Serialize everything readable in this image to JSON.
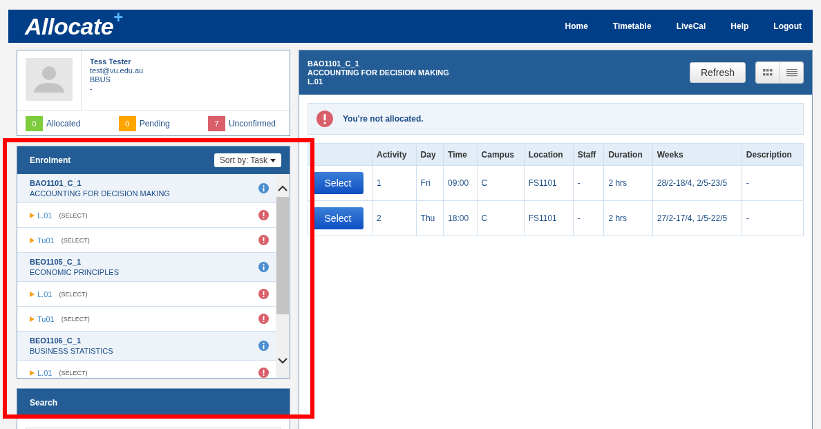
{
  "header": {
    "logo": "Allocate",
    "logo_mark": "+",
    "nav": [
      "Home",
      "Timetable",
      "LiveCal",
      "Help",
      "Logout"
    ]
  },
  "profile": {
    "name": "Tess Tester",
    "email": "test@vu.edu.au",
    "program": "BBUS",
    "extra": "-",
    "counts": [
      {
        "value": "0",
        "label": "Allocated",
        "color": "#7ccc3c"
      },
      {
        "value": "0",
        "label": "Pending",
        "color": "#ffa500"
      },
      {
        "value": "7",
        "label": "Unconfirmed",
        "color": "#d9606a"
      }
    ]
  },
  "enrolment": {
    "title": "Enrolment",
    "sort": "Sort by: Task",
    "courses": [
      {
        "code": "BAO1101_C_1",
        "name": "ACCOUNTING FOR DECISION MAKING",
        "children": [
          {
            "label": "L.01",
            "note": "(SELECT)"
          },
          {
            "label": "Tu01",
            "note": "(SELECT)"
          }
        ]
      },
      {
        "code": "BEO1105_C_1",
        "name": "ECONOMIC PRINCIPLES",
        "children": [
          {
            "label": "L.01",
            "note": "(SELECT)"
          },
          {
            "label": "Tu01",
            "note": "(SELECT)"
          }
        ]
      },
      {
        "code": "BEO1106_C_1",
        "name": "BUSINESS STATISTICS",
        "children": [
          {
            "label": "L.01",
            "note": "(SELECT)"
          }
        ]
      }
    ]
  },
  "search": {
    "title": "Search"
  },
  "detail": {
    "code": "BAO1101_C_1",
    "name": "ACCOUNTING FOR DECISION MAKING",
    "activity": "L.01",
    "refresh": "Refresh",
    "views": [
      {
        "kind": "grid",
        "selected": false
      },
      {
        "kind": "list",
        "selected": false
      }
    ],
    "message": "You're not allocated.",
    "table": {
      "columns": [
        "Activity",
        "Day",
        "Time",
        "Campus",
        "Location",
        "Staff",
        "Duration",
        "Weeks",
        "Description"
      ],
      "rows": [
        {
          "button": "Select",
          "cells": [
            "1",
            "Fri",
            "09:00",
            "C",
            "FS1101",
            "-",
            "2 hrs",
            "28/2-18/4, 2/5-23/5",
            "-"
          ]
        },
        {
          "button": "Select",
          "cells": [
            "2",
            "Thu",
            "18:00",
            "C",
            "FS1101",
            "-",
            "2 hrs",
            "27/2-17/4, 1/5-22/5",
            "-"
          ]
        }
      ]
    }
  },
  "annotation": {
    "kind": "frame",
    "color": "#ff0000"
  }
}
